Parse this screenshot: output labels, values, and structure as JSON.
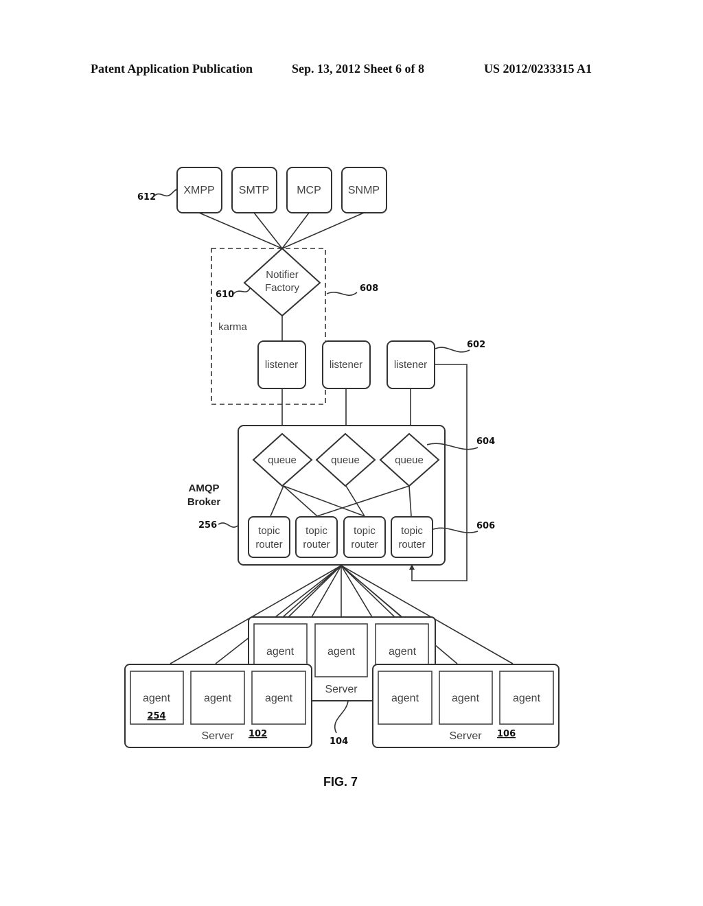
{
  "header": {
    "left": "Patent Application Publication",
    "center": "Sep. 13, 2012   Sheet 6 of 8",
    "right": "US 2012/0233315 A1"
  },
  "figure": {
    "caption": "FIG. 7",
    "protocols": [
      "XMPP",
      "SMTP",
      "MCP",
      "SNMP"
    ],
    "notifier": {
      "line1": "Notifier",
      "line2": "Factory"
    },
    "karma_label": "karma",
    "listeners": [
      "listener",
      "listener",
      "listener"
    ],
    "broker": {
      "line1": "AMQP",
      "line2": "Broker"
    },
    "queues": [
      "queue",
      "queue",
      "queue"
    ],
    "topic_routers": [
      {
        "line1": "topic",
        "line2": "router"
      },
      {
        "line1": "topic",
        "line2": "router"
      },
      {
        "line1": "topic",
        "line2": "router"
      },
      {
        "line1": "topic",
        "line2": "router"
      }
    ],
    "agent_label": "agent",
    "server_label": "Server",
    "refs": {
      "protocols": "612",
      "notifier": "610",
      "karma": "608",
      "listener": "602",
      "queue": "604",
      "topic_router": "606",
      "broker": "256",
      "agent": "254",
      "server_left": "102",
      "server_middle": "104",
      "server_right": "106"
    }
  }
}
